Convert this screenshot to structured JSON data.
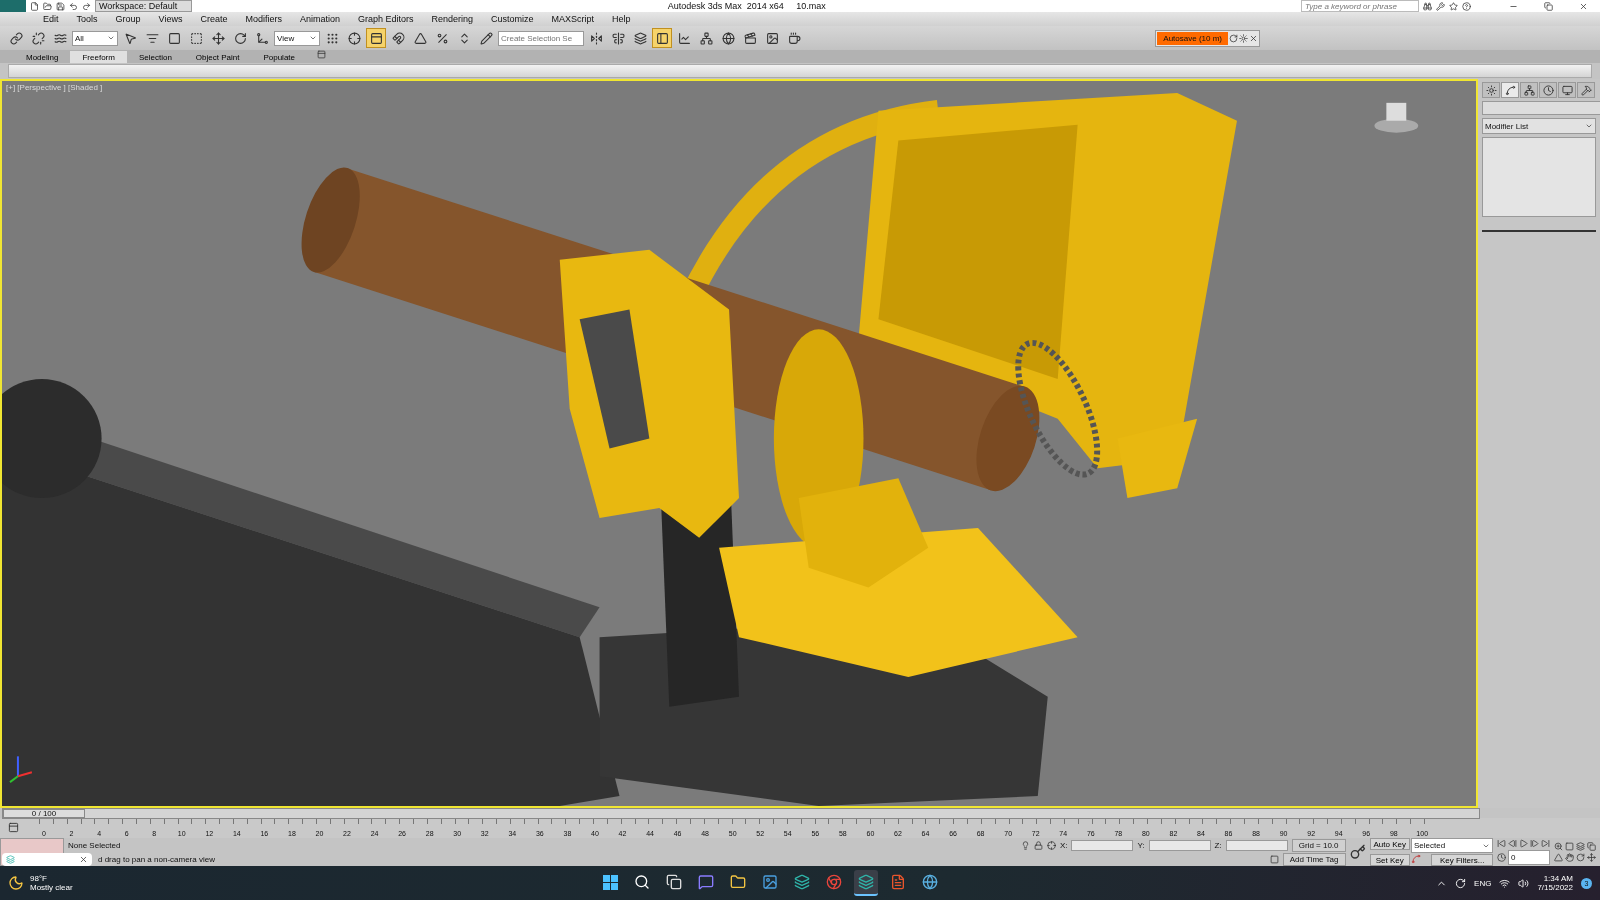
{
  "title_bar": {
    "workspace": "Workspace: Default",
    "title": "Autodesk 3ds Max  2014 x64     10.max",
    "search": {
      "placeholder": "Type a keyword or phrase"
    }
  },
  "menu": [
    "Edit",
    "Tools",
    "Group",
    "Views",
    "Create",
    "Modifiers",
    "Animation",
    "Graph Editors",
    "Rendering",
    "Customize",
    "MAXScript",
    "Help"
  ],
  "toolbar": [
    {
      "kind": "link",
      "pressed": false
    },
    {
      "kind": "unlink",
      "pressed": false
    },
    {
      "kind": "bind",
      "pressed": false
    },
    {
      "kind": "dropdown",
      "value": "All"
    },
    {
      "kind": "select",
      "pressed": false
    },
    {
      "kind": "select-by-name",
      "pressed": false
    },
    {
      "kind": "region",
      "pressed": false
    },
    {
      "kind": "crossing",
      "pressed": false
    },
    {
      "kind": "move",
      "pressed": false
    },
    {
      "kind": "rotate",
      "pressed": false
    },
    {
      "kind": "scale",
      "pressed": false
    },
    {
      "kind": "dropdown",
      "value": "View"
    },
    {
      "kind": "pivot",
      "pressed": false
    },
    {
      "kind": "manipulate",
      "pressed": false
    },
    {
      "kind": "shortcut",
      "pressed": true
    },
    {
      "kind": "snap",
      "pressed": false
    },
    {
      "kind": "angle-snap",
      "pressed": false
    },
    {
      "kind": "percent-snap",
      "pressed": false
    },
    {
      "kind": "spinner-snap",
      "pressed": false
    },
    {
      "kind": "edit-selection",
      "pressed": false
    },
    {
      "kind": "combo",
      "placeholder": "Create Selection Se"
    },
    {
      "kind": "mirror",
      "pressed": false
    },
    {
      "kind": "align",
      "pressed": false
    },
    {
      "kind": "layers",
      "pressed": false
    },
    {
      "kind": "explorer",
      "pressed": true
    },
    {
      "kind": "curve-editor",
      "pressed": false
    },
    {
      "kind": "schematic",
      "pressed": false
    },
    {
      "kind": "material",
      "pressed": false
    },
    {
      "kind": "render-setup",
      "pressed": false
    },
    {
      "kind": "frame-window",
      "pressed": false
    },
    {
      "kind": "render",
      "pressed": false
    }
  ],
  "autosave": {
    "label": "Autosave (10 m)"
  },
  "ribbon_tabs": [
    {
      "label": "Modeling",
      "selected": false
    },
    {
      "label": "Freeform",
      "selected": true
    },
    {
      "label": "Selection",
      "selected": false
    },
    {
      "label": "Object Paint",
      "selected": false
    },
    {
      "label": "Populate",
      "selected": false
    }
  ],
  "viewport": {
    "label": "[+] [Perspective ] [Shaded ]"
  },
  "command_panel": {
    "tabs": [
      {
        "kind": "create",
        "selected": false
      },
      {
        "kind": "modify",
        "selected": true
      },
      {
        "kind": "hierarchy",
        "selected": false
      },
      {
        "kind": "motion",
        "selected": false
      },
      {
        "kind": "display",
        "selected": false
      },
      {
        "kind": "utilities",
        "selected": false
      }
    ],
    "modifier_list": "Modifier List"
  },
  "time_slider": {
    "label": "0 / 100",
    "level": 0
  },
  "ruler": [
    "0",
    "2",
    "4",
    "6",
    "8",
    "10",
    "12",
    "14",
    "16",
    "18",
    "20",
    "22",
    "24",
    "26",
    "28",
    "30",
    "32",
    "34",
    "36",
    "38",
    "40",
    "42",
    "44",
    "46",
    "48",
    "50",
    "52",
    "54",
    "56",
    "58",
    "60",
    "62",
    "64",
    "66",
    "68",
    "70",
    "72",
    "74",
    "76",
    "78",
    "80",
    "82",
    "84",
    "86",
    "88",
    "90",
    "92",
    "94",
    "96",
    "98",
    "100"
  ],
  "status": {
    "selection": "None Selected",
    "prompt": "d drag to pan a non-camera view",
    "x_label": "X:",
    "y_label": "Y:",
    "z_label": "Z:",
    "grid": "Grid = 10.0",
    "time_tag": "Add Time Tag",
    "auto_key": "Auto Key",
    "key_mode": "Selected",
    "set_key": "Set Key",
    "key_filters": "Key Filters...",
    "frame": "0"
  },
  "taskbar": {
    "weather": {
      "temperature": "98°F",
      "condition": "Mostly clear"
    },
    "apps": [
      {
        "kind": "start",
        "active": false
      },
      {
        "kind": "search",
        "active": false
      },
      {
        "kind": "task-view",
        "active": false
      },
      {
        "kind": "chat",
        "active": false
      },
      {
        "kind": "folder",
        "active": false
      },
      {
        "kind": "photos",
        "active": false
      },
      {
        "kind": "max-app",
        "active": false
      },
      {
        "kind": "browser",
        "active": false
      },
      {
        "kind": "max-app",
        "active": true
      },
      {
        "kind": "pdf",
        "active": false
      },
      {
        "kind": "globe",
        "active": false
      }
    ],
    "language": "ENG",
    "time": "1:34 AM",
    "date": "7/15/2022",
    "notifications": "3"
  }
}
